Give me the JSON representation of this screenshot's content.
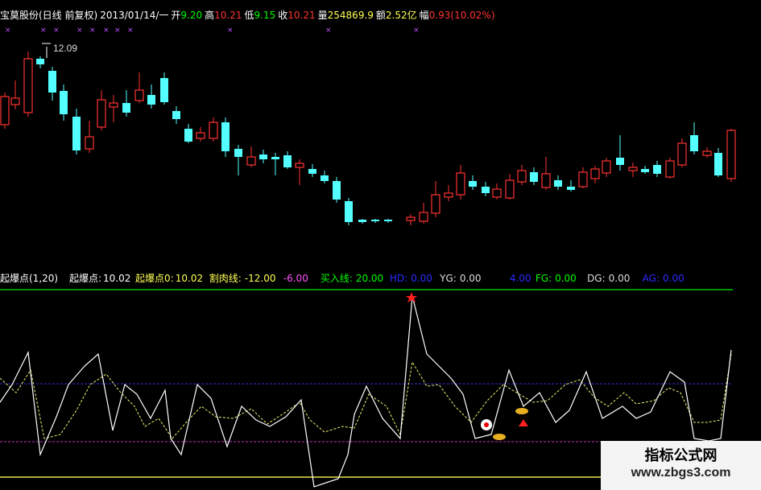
{
  "header": {
    "name": "宝莫股份(日线 前复权)",
    "date": "2013/01/14/一",
    "open_label": "开",
    "open": "9.20",
    "high_label": "高",
    "high": "10.21",
    "low_label": "低",
    "low": "9.15",
    "close_label": "收",
    "close": "10.21",
    "volume_label": "量",
    "volume": "254869.9",
    "amount_label": "额",
    "amount": "2.52亿",
    "change_label": "幅",
    "change": "0.93(10.02%)"
  },
  "price_max_label": "12.09",
  "indicator": {
    "name": "起爆点(1,20)",
    "qbd_label": "起爆点:",
    "qbd_value": "10.02",
    "qbd0_label": "起爆点0:",
    "qbd0_value": "10.02",
    "gerou_label": "割肉线:",
    "gerou_value": "-12.00",
    "blank1_value": "-6.00",
    "buy_label": "买入线:",
    "buy_value": "20.00",
    "hd_label": "HD:",
    "hd_value": "0.00",
    "yg_label": "YG:",
    "yg_value": "0.00",
    "blank2_value": "4.00",
    "fg_label": "FG:",
    "fg_value": "0.00",
    "dg_label": "DG:",
    "dg_value": "0.00",
    "ag_label": "AG:",
    "ag_value": "0.00"
  },
  "colors": {
    "up": "#ff3232",
    "down": "#54ffff",
    "green": "#00ff00",
    "yellow": "#ffff54",
    "magenta": "#ff54ff",
    "blue": "#2b2bff",
    "white": "#ffffff"
  },
  "watermark": {
    "line1": "指标公式网",
    "line2": "www.zbgs3.com"
  }
}
